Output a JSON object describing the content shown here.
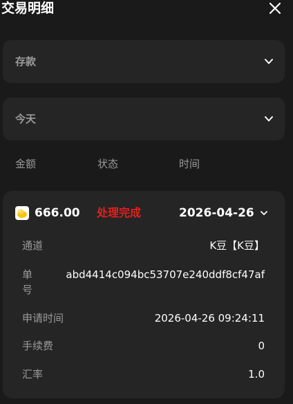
{
  "header": {
    "title": "交易明细",
    "close_icon": "close-icon"
  },
  "filters": {
    "type": {
      "selected": "存款",
      "icon": "chevron-down-icon"
    },
    "date_range": {
      "selected": "今天",
      "icon": "chevron-down-icon"
    }
  },
  "columns": {
    "amount": "金额",
    "status": "状态",
    "time": "时间"
  },
  "transaction": {
    "coin_icon": "k-bean-coin-icon",
    "amount": "666.00",
    "status": "处理完成",
    "date": "2026-04-26",
    "expand_icon": "chevron-down-icon",
    "details": {
      "channel_label": "通道",
      "channel_value": "K豆【K豆】",
      "order_label": "单号",
      "order_value": "abd4414c094bc53707e240ddf8cf47af",
      "apply_time_label": "申请时间",
      "apply_time_value": "2026-04-26 09:24:11",
      "fee_label": "手续费",
      "fee_value": "0",
      "rate_label": "汇率",
      "rate_value": "1.0"
    }
  },
  "colors": {
    "background": "#1a1a1a",
    "panel": "#252525",
    "muted_text": "#9a9a9a",
    "status_red": "#e0211e",
    "coin_yellow": "#f5c518"
  }
}
